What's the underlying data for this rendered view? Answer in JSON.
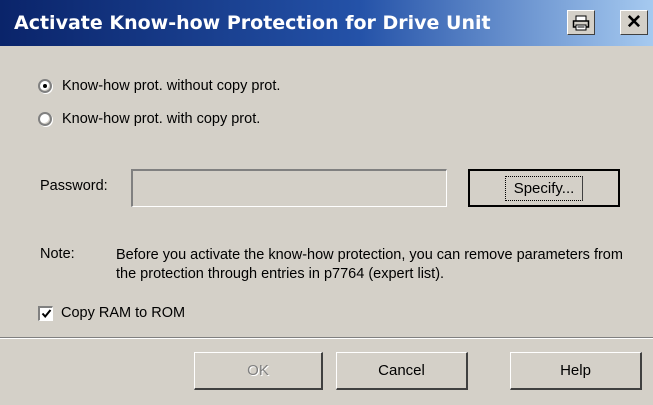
{
  "window": {
    "title": "Activate Know-how Protection for Drive Unit",
    "icons": {
      "print": "print-icon",
      "close": "close-icon"
    }
  },
  "protection_mode": {
    "options": [
      {
        "label": "Know-how prot. without copy prot.",
        "checked": true
      },
      {
        "label": "Know-how prot. with copy prot.",
        "checked": false
      }
    ]
  },
  "password": {
    "label": "Password:",
    "value": "",
    "specify_label": "Specify..."
  },
  "note": {
    "label": "Note:",
    "text": "Before you activate the know-how protection, you can remove parameters from the protection through entries in p7764 (expert list)."
  },
  "copy_ram": {
    "label": "Copy RAM to ROM",
    "checked": true
  },
  "buttons": {
    "ok": "OK",
    "cancel": "Cancel",
    "help": "Help"
  },
  "colors": {
    "title_gradient_start": "#0a246a",
    "title_gradient_end": "#a6caf0",
    "dialog_bg": "#d4d0c8",
    "disabled_text": "#808080"
  }
}
